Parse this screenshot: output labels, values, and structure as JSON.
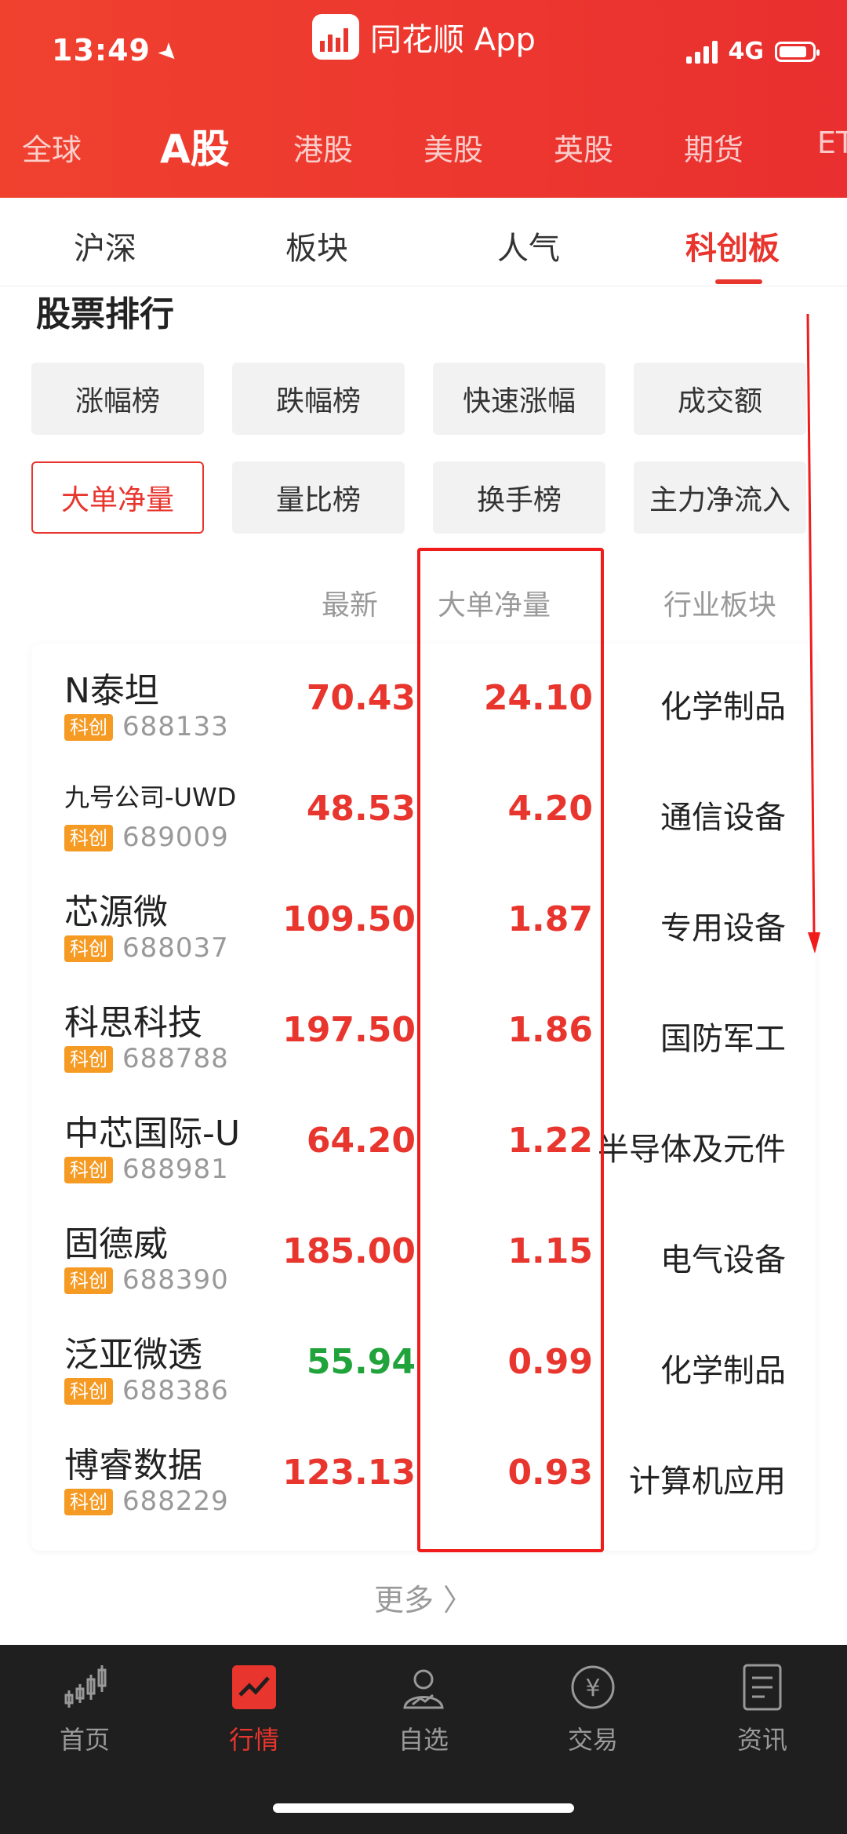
{
  "status": {
    "time": "13:49",
    "network": "4G"
  },
  "app": {
    "title": "同花顺 App"
  },
  "market_tabs": [
    "全球",
    "A股",
    "港股",
    "美股",
    "英股",
    "期货",
    "ET"
  ],
  "sub_tabs": [
    "沪深",
    "板块",
    "人气",
    "科创板"
  ],
  "section_title": "股票排行",
  "filters": [
    "涨幅榜",
    "跌幅榜",
    "快速涨幅",
    "成交额",
    "大单净量",
    "量比榜",
    "换手榜",
    "主力净流入"
  ],
  "columns": {
    "latest": "最新",
    "net": "大单净量",
    "industry": "行业板块"
  },
  "tag_label": "科创",
  "rows": [
    {
      "name": "N泰坦",
      "code": "688133",
      "price": "70.43",
      "net": "24.10",
      "industry": "化学制品"
    },
    {
      "name": "九号公司-UWD",
      "code": "689009",
      "price": "48.53",
      "net": "4.20",
      "industry": "通信设备"
    },
    {
      "name": "芯源微",
      "code": "688037",
      "price": "109.50",
      "net": "1.87",
      "industry": "专用设备"
    },
    {
      "name": "科思科技",
      "code": "688788",
      "price": "197.50",
      "net": "1.86",
      "industry": "国防军工"
    },
    {
      "name": "中芯国际-U",
      "code": "688981",
      "price": "64.20",
      "net": "1.22",
      "industry": "半导体及元件"
    },
    {
      "name": "固德威",
      "code": "688390",
      "price": "185.00",
      "net": "1.15",
      "industry": "电气设备"
    },
    {
      "name": "泛亚微透",
      "code": "688386",
      "price": "55.94",
      "net": "0.99",
      "industry": "化学制品"
    },
    {
      "name": "博睿数据",
      "code": "688229",
      "price": "123.13",
      "net": "0.93",
      "industry": "计算机应用"
    }
  ],
  "more": "更多 〉",
  "bottom_nav": [
    "首页",
    "行情",
    "自选",
    "交易",
    "资讯"
  ],
  "colors": {
    "brand_red": "#e8352d",
    "down_green": "#1fa33a",
    "kc_tag": "#f59a23",
    "annotation_red": "#f01c1c"
  }
}
